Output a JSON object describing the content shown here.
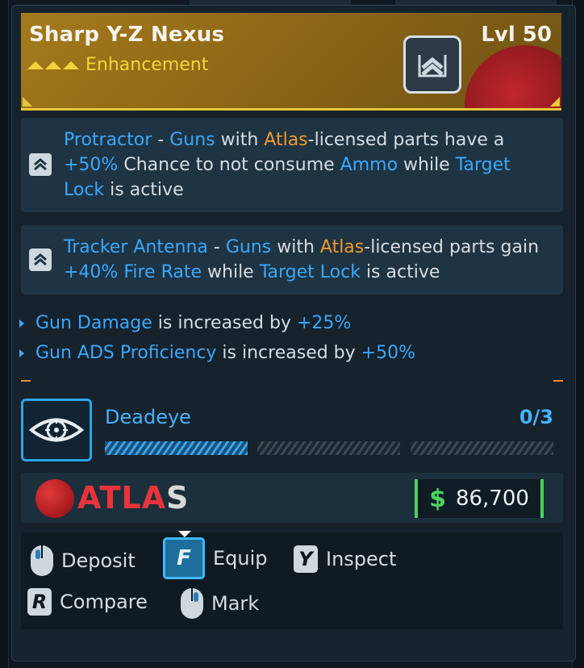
{
  "item": {
    "name": "Sharp Y-Z Nexus",
    "level": "Lvl 50",
    "rarity": "Enhancement",
    "rarity_color": "#f6d43a",
    "icon": "chevron-rank-icon"
  },
  "perks": [
    {
      "icon": "chevron-up-icon",
      "parts": [
        {
          "text": "Protractor",
          "style": "hl"
        },
        {
          "text": " - ",
          "style": ""
        },
        {
          "text": "Guns",
          "style": "hl"
        },
        {
          "text": " with ",
          "style": ""
        },
        {
          "text": "Atlas",
          "style": "or"
        },
        {
          "text": "-licensed parts have a ",
          "style": ""
        },
        {
          "text": "+50%",
          "style": "hl"
        },
        {
          "text": " Chance to not consume ",
          "style": ""
        },
        {
          "text": "Ammo",
          "style": "hl"
        },
        {
          "text": " while ",
          "style": ""
        },
        {
          "text": "Target Lock",
          "style": "hl"
        },
        {
          "text": " is active",
          "style": ""
        }
      ]
    },
    {
      "icon": "chevron-up-icon",
      "parts": [
        {
          "text": "Tracker Antenna",
          "style": "hl"
        },
        {
          "text": " - ",
          "style": ""
        },
        {
          "text": "Guns",
          "style": "hl"
        },
        {
          "text": " with ",
          "style": ""
        },
        {
          "text": "Atlas",
          "style": "or"
        },
        {
          "text": "-licensed parts gain ",
          "style": ""
        },
        {
          "text": "+40% Fire Rate",
          "style": "hl"
        },
        {
          "text": " while ",
          "style": ""
        },
        {
          "text": "Target Lock",
          "style": "hl"
        },
        {
          "text": " is active",
          "style": ""
        }
      ]
    }
  ],
  "stats": [
    {
      "name": "Gun Damage",
      "middle": " is increased by ",
      "value": "+25%"
    },
    {
      "name": "Gun ADS Proficiency",
      "middle": " is increased by ",
      "value": "+50%"
    }
  ],
  "skill": {
    "name": "Deadeye",
    "rank": "0/3",
    "pips_filled": 1,
    "pips_total": 3,
    "icon": "eye-target-icon"
  },
  "manufacturer": {
    "name_a": "ATLA",
    "name_b": "S",
    "logo": "atlas-logo"
  },
  "value": {
    "currency_symbol": "$",
    "amount": "86,700",
    "accent": "#4cd35e"
  },
  "actions": {
    "deposit": "Deposit",
    "equip": "Equip",
    "equip_key": "F",
    "inspect": "Inspect",
    "inspect_key": "Y",
    "compare": "Compare",
    "compare_key": "R",
    "mark": "Mark"
  },
  "colors": {
    "highlight": "#3aa8ff",
    "manufacturer": "#f19a2d",
    "header": "#a47a1c"
  }
}
